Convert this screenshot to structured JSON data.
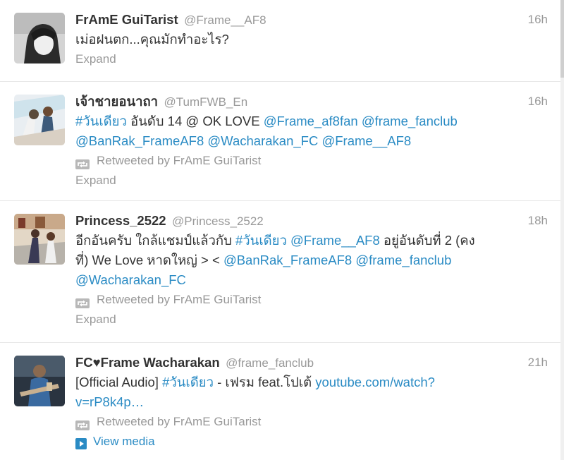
{
  "tweets": [
    {
      "fullname": "FrAmE GuiTarist",
      "username": "@Frame__AF8",
      "time": "16h",
      "text": "เม่อฝนตก...คุณมักทำอะไร?",
      "action": "Expand"
    },
    {
      "fullname": "เจ้าชายอนาถา",
      "username": "@TumFWB_En",
      "time": "16h",
      "line1": {
        "hashtag": "#วันเดียว",
        "plain": " อันดับ 14 @ OK LOVE ",
        "mention1": "@Frame_af8fan",
        "space": " ",
        "mention2": "@frame_fanclub"
      },
      "line2": {
        "mention1": "@BanRak_FrameAF8",
        "mention2": "@Wacharakan_FC",
        "mention3": "@Frame__AF8"
      },
      "retweeted_by": "Retweeted by FrAmE GuiTarist",
      "action": "Expand"
    },
    {
      "fullname": "Princess_2522",
      "username": "@Princess_2522",
      "time": "18h",
      "line1": {
        "plain1": "อีกอันครับ ใกล้แชมป์แล้วกับ ",
        "hashtag": "#วันเดียว",
        "mention1": "@Frame__AF8",
        "plain2": " อยู่อันดับที่ 2 (คง"
      },
      "line2": {
        "plain": "ที่) We Love หาดใหญ่ > < ",
        "mention1": "@BanRak_FrameAF8",
        "mention2": "@frame_fanclub"
      },
      "line3": {
        "mention1": "@Wacharakan_FC"
      },
      "retweeted_by": "Retweeted by FrAmE GuiTarist",
      "action": "Expand"
    },
    {
      "fullname": "FC♥Frame Wacharakan",
      "username": "@frame_fanclub",
      "time": "21h",
      "line1": {
        "plain1": "[Official Audio] ",
        "hashtag": "#วันเดียว",
        "plain2": " - เฟรม feat.โปเต้ ",
        "link": "youtube.com/watch?"
      },
      "line2": {
        "link": "v=rP8k4p…"
      },
      "retweeted_by": "Retweeted by FrAmE GuiTarist",
      "action": "View media"
    }
  ],
  "colors": {
    "link": "#2a8bc4",
    "meta": "#999999",
    "text": "#333333"
  },
  "icons": {
    "retweet": "retweet-icon",
    "media": "play-icon"
  }
}
